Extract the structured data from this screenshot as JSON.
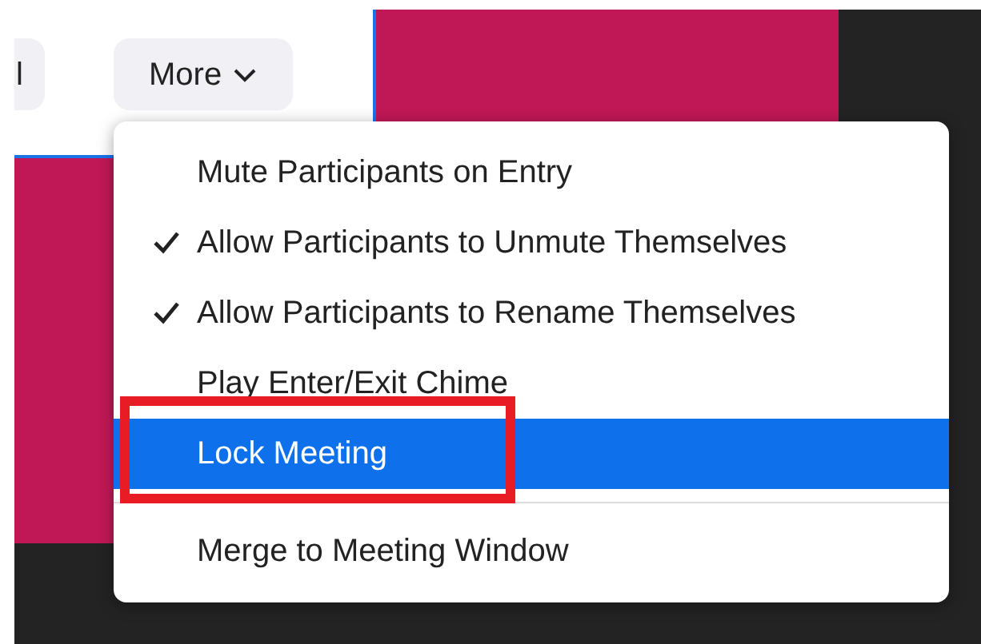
{
  "toolbar": {
    "buttons": [
      {
        "label": "l",
        "kind": "plain"
      },
      {
        "label": "More",
        "kind": "dropdown"
      }
    ]
  },
  "menu": {
    "items": [
      {
        "label": "Mute Participants on Entry",
        "checked": false,
        "selected": false
      },
      {
        "label": "Allow Participants to Unmute Themselves",
        "checked": true,
        "selected": false
      },
      {
        "label": "Allow Participants to Rename Themselves",
        "checked": true,
        "selected": false
      },
      {
        "label": "Play Enter/Exit Chime",
        "checked": false,
        "selected": false
      },
      {
        "label": "Lock Meeting",
        "checked": false,
        "selected": true
      },
      {
        "label": "Merge to Meeting Window",
        "checked": false,
        "selected": false,
        "separator_before": true
      }
    ]
  }
}
